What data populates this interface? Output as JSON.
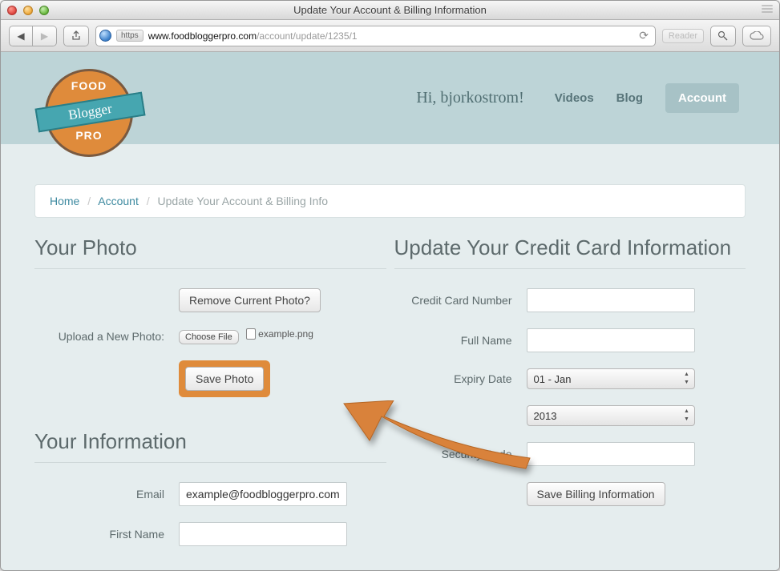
{
  "window": {
    "title": "Update Your Account & Billing Information"
  },
  "url": {
    "https_label": "https",
    "host": "www.foodbloggerpro.com",
    "path": "/account/update/1235/1",
    "reader_label": "Reader"
  },
  "logo": {
    "top": "FOOD",
    "mid": "Blogger",
    "bot": "PRO"
  },
  "nav": {
    "greeting": "Hi, bjorkostrom!",
    "videos": "Videos",
    "blog": "Blog",
    "account": "Account"
  },
  "crumbs": {
    "home": "Home",
    "account": "Account",
    "current": "Update Your Account & Billing Info"
  },
  "photo": {
    "heading": "Your Photo",
    "remove_btn": "Remove Current Photo?",
    "upload_label": "Upload a New Photo:",
    "choose_btn": "Choose File",
    "chosen_file": "example.png",
    "save_btn": "Save Photo"
  },
  "info": {
    "heading": "Your Information",
    "email_label": "Email",
    "email_value": "example@foodbloggerpro.com",
    "first_name_label": "First Name"
  },
  "billing": {
    "heading": "Update Your Credit Card Information",
    "cc_label": "Credit Card Number",
    "name_label": "Full Name",
    "expiry_label": "Expiry Date",
    "month_value": "01 - Jan",
    "year_value": "2013",
    "cvc_label": "Security Code",
    "save_btn": "Save Billing Information"
  }
}
